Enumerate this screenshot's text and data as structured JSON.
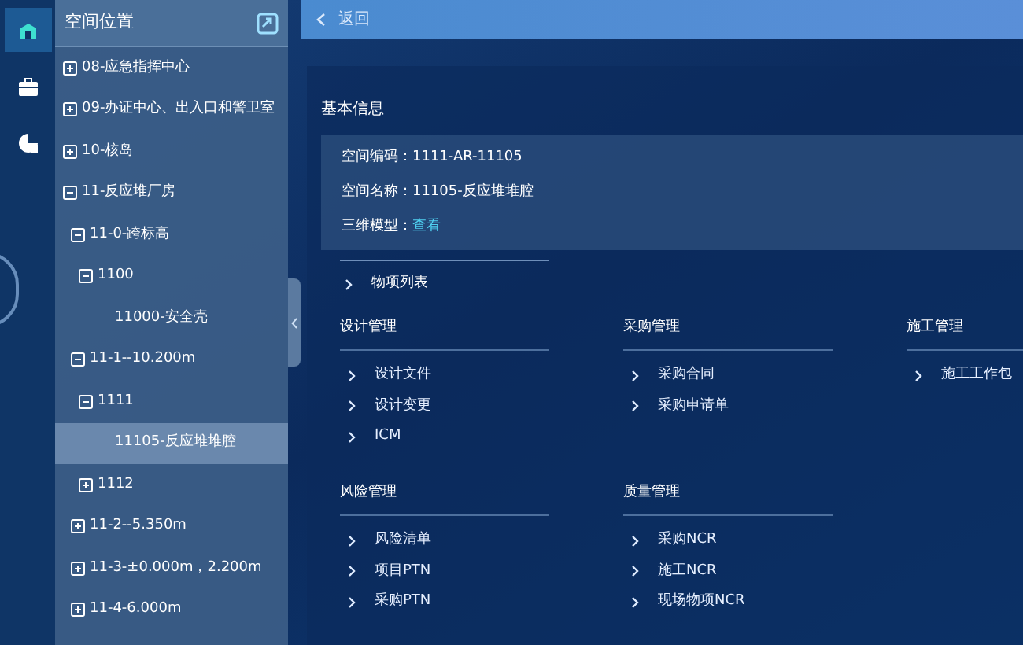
{
  "nav_rail": {
    "items": [
      {
        "selected": true
      },
      {
        "selected": false
      },
      {
        "selected": false
      }
    ]
  },
  "sidebar": {
    "title": "空间位置",
    "tree": [
      {
        "label": "08-应急指挥中心",
        "expanded": false,
        "selected": false
      },
      {
        "label": "09-办证中心、出入口和警卫室",
        "expanded": false,
        "selected": false
      },
      {
        "label": "10-核岛",
        "expanded": false,
        "selected": false
      },
      {
        "label": "11-反应堆厂房",
        "expanded": true,
        "selected": false,
        "children": [
          {
            "label": "11-0-跨标高",
            "expanded": true,
            "selected": false,
            "children": [
              {
                "label": "1100",
                "expanded": true,
                "selected": false,
                "children": [
                  {
                    "label": "11000-安全壳",
                    "selected": false
                  }
                ]
              }
            ]
          },
          {
            "label": "11-1--10.200m",
            "expanded": true,
            "selected": false,
            "children": [
              {
                "label": "1111",
                "expanded": true,
                "selected": false,
                "children": [
                  {
                    "label": "11105-反应堆堆腔",
                    "selected": true
                  }
                ]
              },
              {
                "label": "1112",
                "expanded": false,
                "selected": false
              }
            ]
          },
          {
            "label": "11-2--5.350m",
            "expanded": false,
            "selected": false
          },
          {
            "label": "11-3-±0.000m，2.200m",
            "expanded": false,
            "selected": false
          },
          {
            "label": "11-4-6.000m",
            "expanded": false,
            "selected": false
          }
        ]
      }
    ]
  },
  "top_bar": {
    "back_label": "返回"
  },
  "basic_info": {
    "title": "基本信息",
    "fields": [
      {
        "label": "空间编码：",
        "value": "1111-AR-11105",
        "kind": "text"
      },
      {
        "label": "空间名称：",
        "value": "11105-反应堆堆腔",
        "kind": "text"
      },
      {
        "label": "三维模型：",
        "value": "查看",
        "kind": "link"
      }
    ],
    "item_list_link": "物项列表"
  },
  "sections": [
    {
      "title": "设计管理",
      "links": [
        "设计文件",
        "设计变更",
        "ICM"
      ]
    },
    {
      "title": "采购管理",
      "links": [
        "采购合同",
        "采购申请单"
      ]
    },
    {
      "title": "施工管理",
      "links": [
        "施工工作包"
      ]
    },
    {
      "title": "风险管理",
      "links": [
        "风险清单",
        "项目PTN",
        "采购PTN"
      ]
    },
    {
      "title": "质量管理",
      "links": [
        "采购NCR",
        "施工NCR",
        "现场物项NCR"
      ]
    }
  ]
}
